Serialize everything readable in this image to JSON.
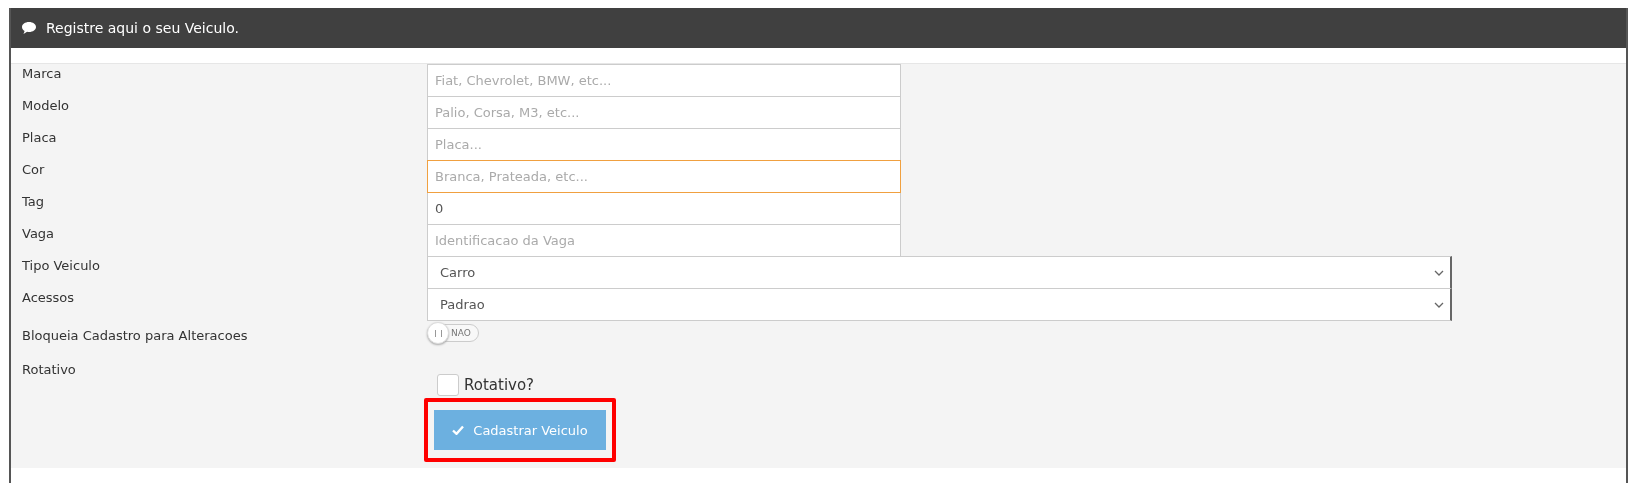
{
  "panel": {
    "title": "Registre aqui o seu Veiculo."
  },
  "fields": [
    {
      "kind": "input",
      "label": "Marca",
      "placeholder": "Fiat, Chevrolet, BMW, etc...",
      "focused": false
    },
    {
      "kind": "input",
      "label": "Modelo",
      "placeholder": "Palio, Corsa, M3, etc...",
      "focused": false
    },
    {
      "kind": "input",
      "label": "Placa",
      "placeholder": "Placa...",
      "focused": false
    },
    {
      "kind": "input",
      "label": "Cor",
      "placeholder": "Branca, Prateada, etc...",
      "focused": true
    },
    {
      "kind": "input",
      "label": "Tag",
      "value": "0",
      "focused": false
    },
    {
      "kind": "input",
      "label": "Vaga",
      "placeholder": "Identificacao da Vaga",
      "focused": false
    },
    {
      "kind": "select",
      "label": "Tipo Veiculo",
      "value": "Carro"
    },
    {
      "kind": "select",
      "label": "Acessos",
      "value": "Padrao"
    },
    {
      "kind": "toggle",
      "label": "Bloqueia Cadastro para Alteracoes",
      "on": false,
      "state_text": "NAO"
    },
    {
      "kind": "checkbox",
      "label": "Rotativo",
      "checkbox_label": "Rotativo?",
      "checked": false
    }
  ],
  "submit": {
    "label": "Cadastrar Veiculo",
    "highlighted": true
  }
}
